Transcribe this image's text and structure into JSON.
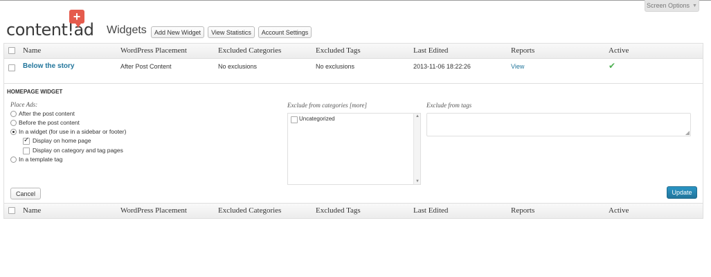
{
  "header": {
    "screen_options": "Screen Options",
    "logo": {
      "text": "content!ad",
      "plus": "+"
    },
    "title": "Widgets",
    "buttons": {
      "add_new": "Add New Widget",
      "view_statistics": "View Statistics",
      "account_settings": "Account Settings"
    }
  },
  "table": {
    "columns": [
      "Name",
      "WordPress Placement",
      "Excluded Categories",
      "Excluded Tags",
      "Last Edited",
      "Reports",
      "Active"
    ],
    "rows": [
      {
        "name": "Below the story",
        "placement": "After Post Content",
        "excluded_categories": "No exclusions",
        "excluded_tags": "No exclusions",
        "last_edited": "2013-11-06 18:22:26",
        "reports": "View",
        "active": "✔"
      }
    ]
  },
  "editor": {
    "title": "HOMEPAGE WIDGET",
    "place_ads_label": "Place Ads:",
    "place_options": [
      {
        "label": "After the post content",
        "checked": false
      },
      {
        "label": "Before the post content",
        "checked": false
      },
      {
        "label": "In a widget (for use in a sidebar or footer)",
        "checked": true
      },
      {
        "label": "In a template tag",
        "checked": false
      }
    ],
    "widget_suboptions": [
      {
        "label": "Display on home page",
        "checked": true
      },
      {
        "label": "Display on category and tag pages",
        "checked": false
      }
    ],
    "exclude_categories_label": "Exclude from categories [more]",
    "categories": [
      {
        "label": "Uncategorized",
        "checked": false
      }
    ],
    "exclude_tags_label": "Exclude from tags",
    "exclude_tags_value": "",
    "cancel_label": "Cancel",
    "update_label": "Update"
  },
  "colors": {
    "link": "#21759b",
    "update_button": "#21759b",
    "logo_accent": "#e55b4d",
    "active_check": "#4caf50"
  }
}
